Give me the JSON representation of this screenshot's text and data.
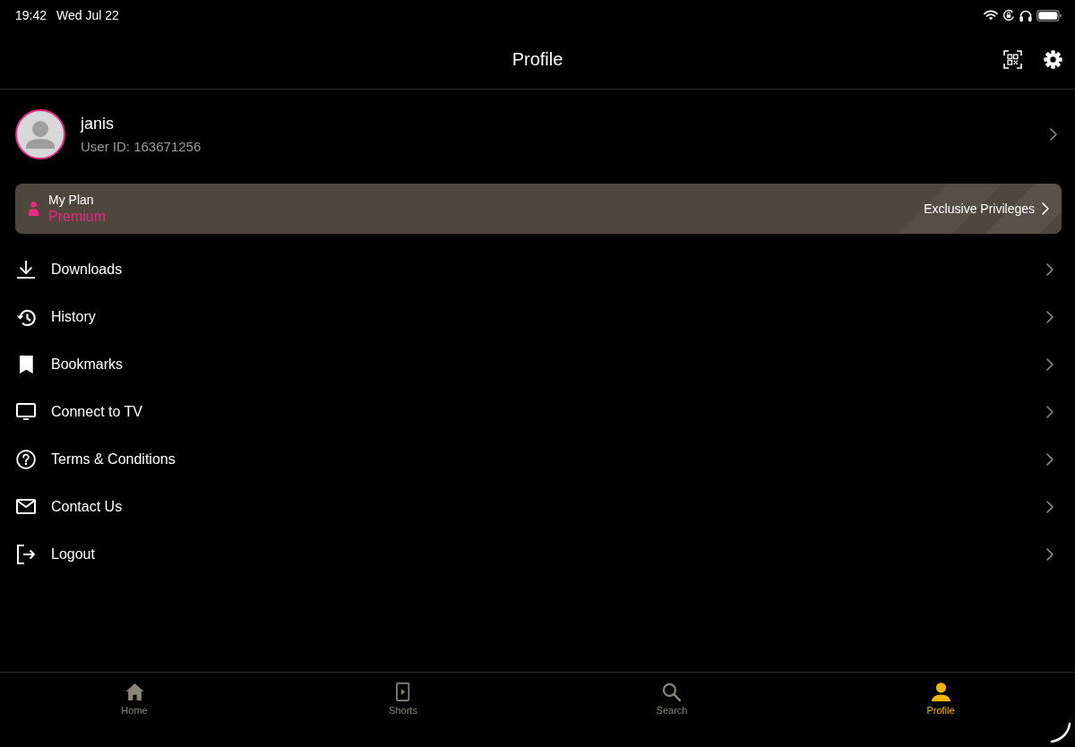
{
  "status_bar": {
    "time": "19:42",
    "date": "Wed Jul 22"
  },
  "header": {
    "title": "Profile"
  },
  "profile": {
    "name": "janis",
    "user_id": "User ID: 163671256"
  },
  "plan": {
    "label": "My Plan",
    "tier": "Premium",
    "link": "Exclusive Privileges"
  },
  "menu": [
    {
      "kind": "downloads",
      "label": "Downloads"
    },
    {
      "kind": "history",
      "label": "History"
    },
    {
      "kind": "bookmarks",
      "label": "Bookmarks"
    },
    {
      "kind": "tv",
      "label": "Connect to TV"
    },
    {
      "kind": "terms",
      "label": "Terms & Conditions"
    },
    {
      "kind": "contact",
      "label": "Contact Us"
    },
    {
      "kind": "logout",
      "label": "Logout"
    }
  ],
  "tabs": [
    {
      "kind": "home",
      "label": "Home",
      "selected": false
    },
    {
      "kind": "shorts",
      "label": "Shorts",
      "selected": false
    },
    {
      "kind": "search",
      "label": "Search",
      "selected": false
    },
    {
      "kind": "profile",
      "label": "Profile",
      "selected": true
    }
  ]
}
